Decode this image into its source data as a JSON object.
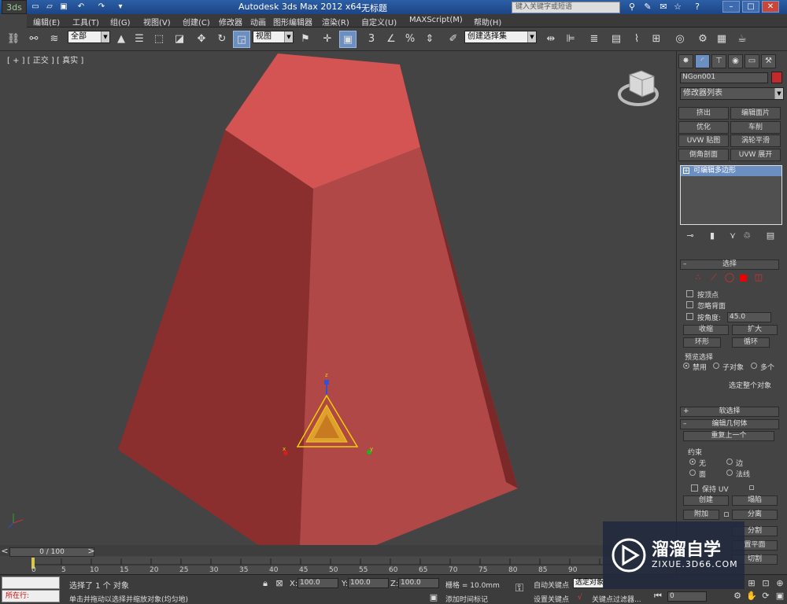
{
  "app": {
    "title": "Autodesk 3ds Max  2012 x64",
    "file": "无标题",
    "search_placeholder": "键入关键字或短语",
    "logo": "3ds"
  },
  "menu": [
    "编辑(E)",
    "工具(T)",
    "组(G)",
    "视图(V)",
    "创建(C)",
    "修改器",
    "动画",
    "图形编辑器",
    "渲染(R)",
    "自定义(U)",
    "MAXScript(M)",
    "帮助(H)"
  ],
  "toolbar": {
    "selection_filter": "全部",
    "ref_coord": "视图",
    "named_selection": "创建选择集"
  },
  "viewport": {
    "label": "[ + ] [ 正交 ] [ 真实 ]",
    "axis_x": "x",
    "axis_y": "y",
    "axis_z": "z"
  },
  "command_panel": {
    "object_name": "NGon001",
    "object_color": "#c42a2a",
    "modifier_list": "修改器列表",
    "quick_buttons": [
      "挤出",
      "编辑面片",
      "优化",
      "车削",
      "UVW 贴图",
      "涡轮平滑",
      "倒角剖面",
      "UVW 展开"
    ],
    "stack_item": "可编辑多边形",
    "selection_rollout": "选择",
    "by_vertex": "按顶点",
    "ignore_backfacing": "忽略背面",
    "by_angle": "按角度:",
    "angle_value": "45.0",
    "shrink": "收缩",
    "grow": "扩大",
    "ring": "环形",
    "loop": "循环",
    "preview_selection": "预览选择",
    "preview_options": [
      "禁用",
      "子对象",
      "多个"
    ],
    "select_whole": "选定整个对象",
    "soft_selection": "软选择",
    "edit_geometry": "编辑几何体",
    "repeat_last": "重复上一个",
    "constraints": "约束",
    "constraint_options": [
      "无",
      "边",
      "面",
      "法线"
    ],
    "preserve_uv": "保持 UV",
    "create": "创建",
    "collapse": "塌陷",
    "attach": "附加",
    "detach": "分离",
    "slice": "分割",
    "reset_plane": "置平面",
    "cut": "切割"
  },
  "timeline": {
    "frame_display": "0 / 100",
    "ticks": [
      "0",
      "5",
      "10",
      "15",
      "20",
      "25",
      "30",
      "35",
      "40",
      "45",
      "50",
      "55",
      "60",
      "65",
      "70",
      "75",
      "80",
      "85",
      "90"
    ]
  },
  "status": {
    "running": "所在行:",
    "selected": "选择了 1 个 对象",
    "prompt": "单击并拖动以选择并缩放对象(均匀地)",
    "x_label": "X:",
    "x_value": "100.0",
    "y_label": "Y:",
    "y_value": "100.0",
    "z_label": "Z:",
    "z_value": "100.0",
    "grid": "栅格 = 10.0mm",
    "add_time_tag": "添加时间标记",
    "auto_key": "自动关键点",
    "selected_set": "选定对象",
    "set_key": "设置关键点",
    "key_filters": "关键点过滤器...",
    "frame_field": "0"
  },
  "watermark": {
    "brand": "溜溜自学",
    "url": "ZIXUE.3D66.COM"
  },
  "colors": {
    "object_top": "#d45454",
    "object_left": "#8a2e2e",
    "object_right": "#b04848",
    "selection_blue": "#6c8fc2"
  }
}
